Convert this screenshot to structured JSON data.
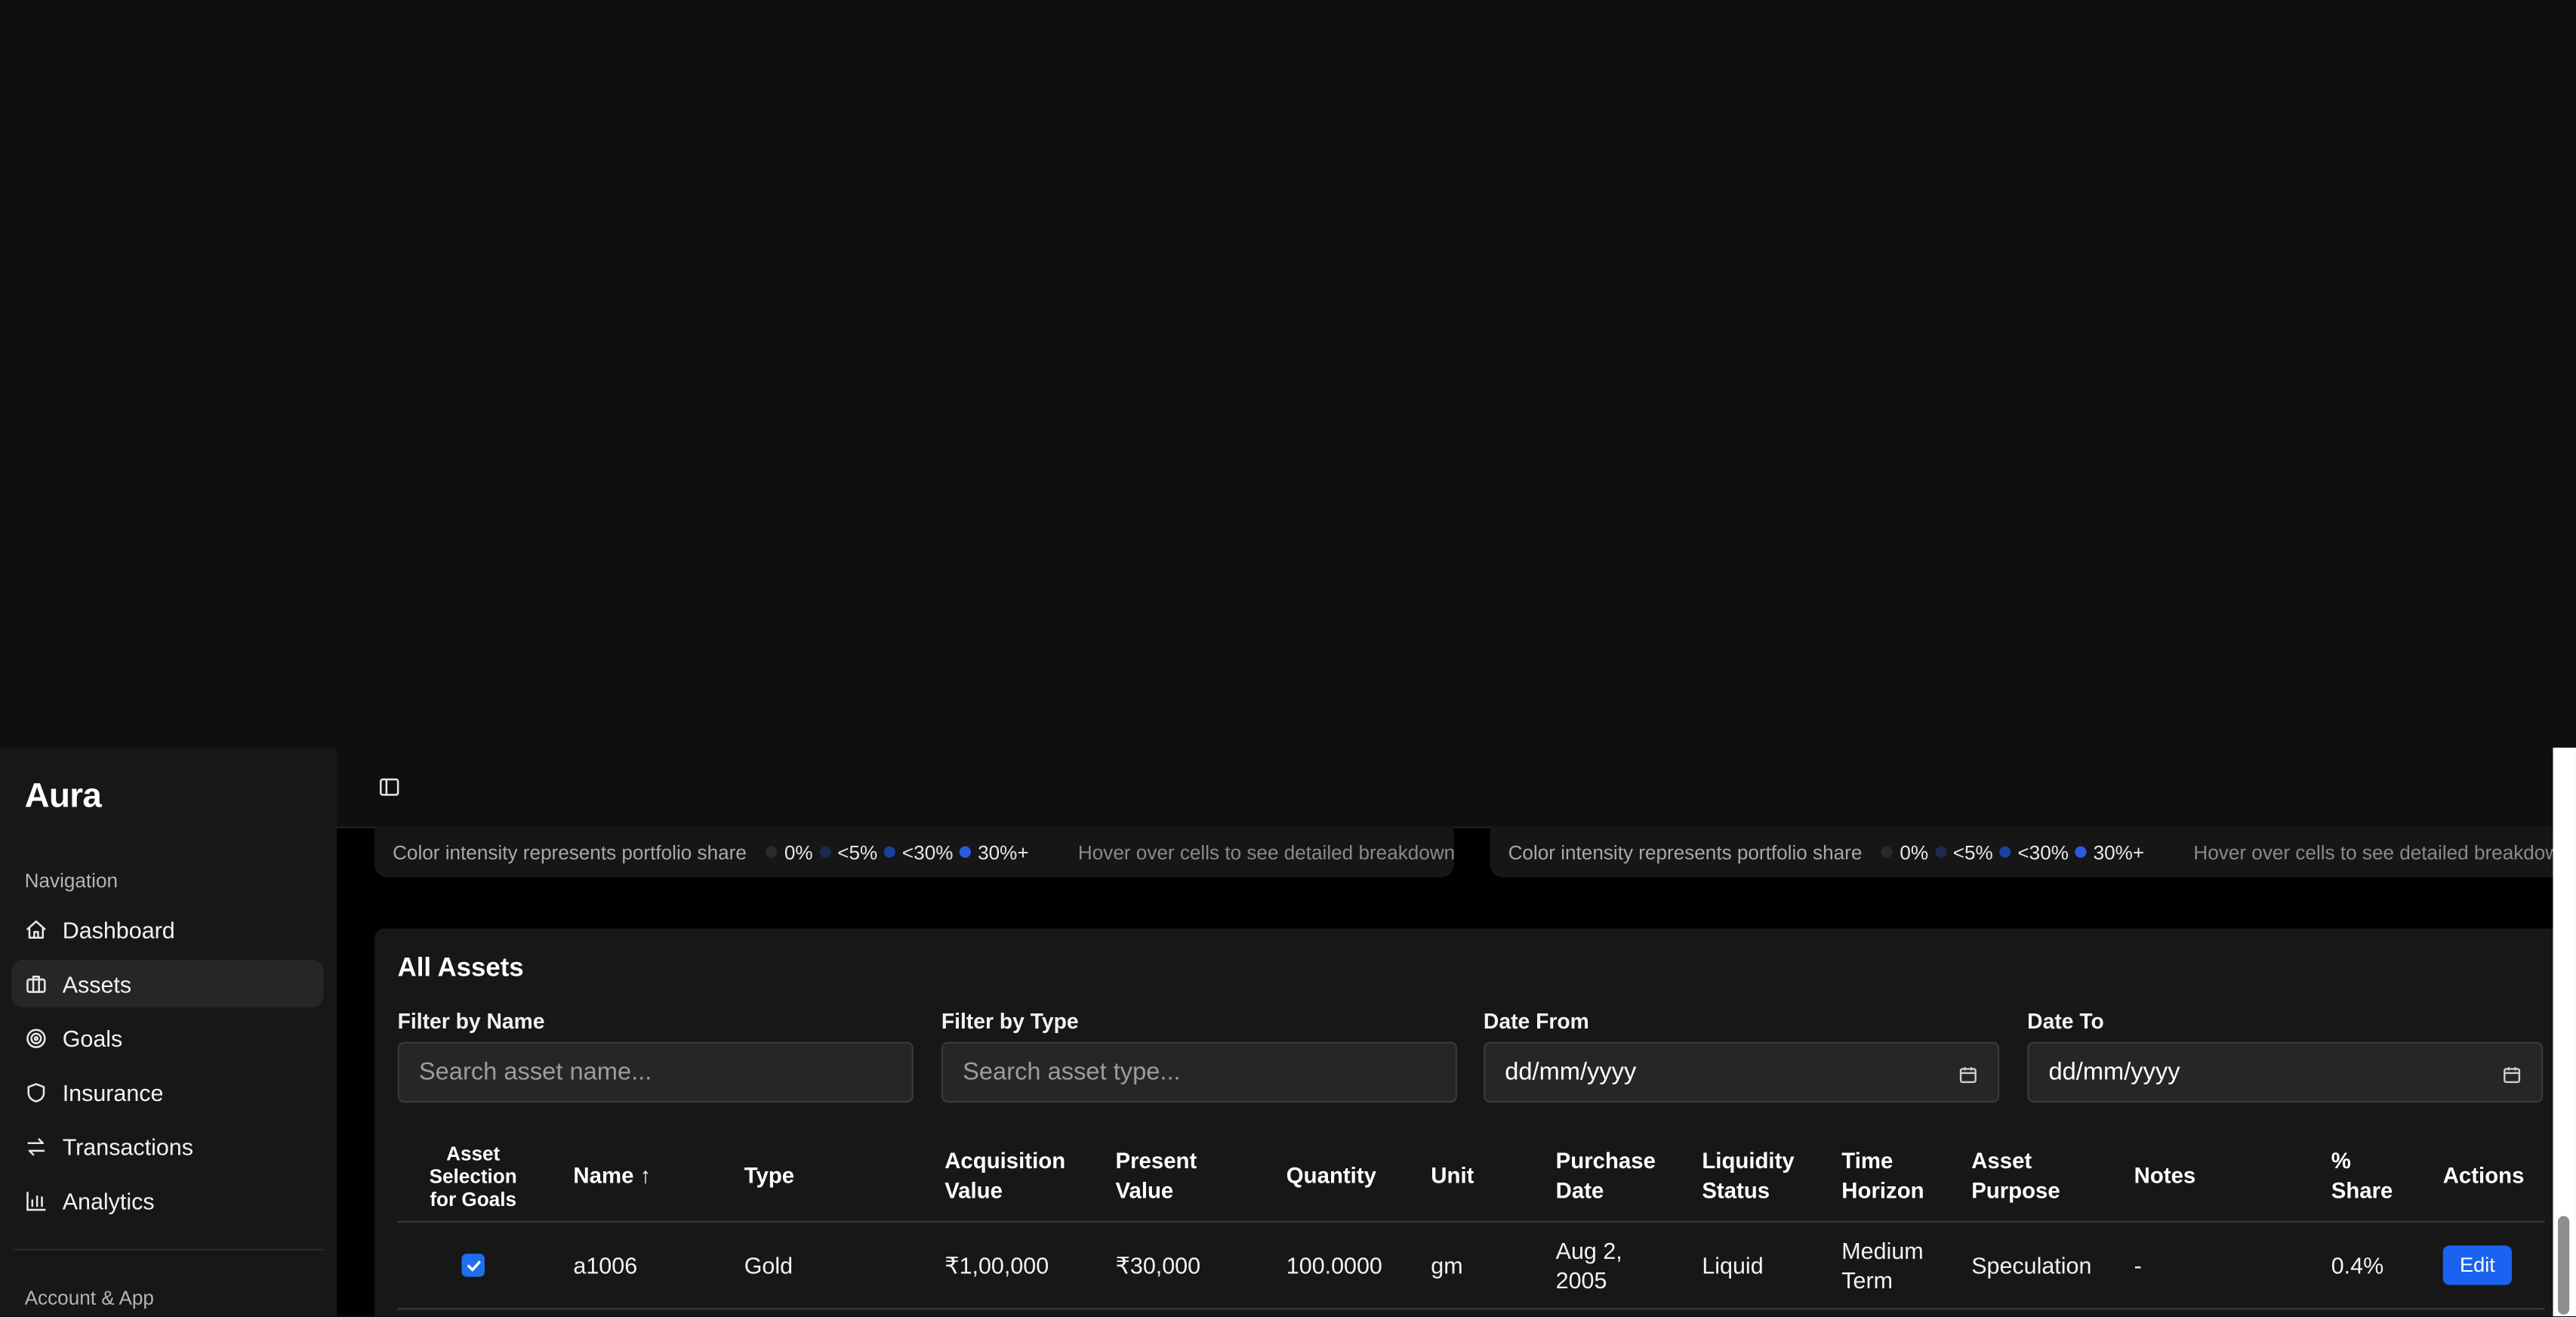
{
  "app": {
    "name": "Aura"
  },
  "sidebar": {
    "section_label": "Navigation",
    "items": [
      {
        "label": "Dashboard",
        "icon": "home-icon",
        "active": false
      },
      {
        "label": "Assets",
        "icon": "briefcase-icon",
        "active": true
      },
      {
        "label": "Goals",
        "icon": "target-icon",
        "active": false
      },
      {
        "label": "Insurance",
        "icon": "shield-icon",
        "active": false
      },
      {
        "label": "Transactions",
        "icon": "arrows-swap-icon",
        "active": false
      },
      {
        "label": "Analytics",
        "icon": "bar-chart-icon",
        "active": false
      }
    ],
    "section2_label": "Account & App"
  },
  "topbar": {
    "toggle_icon": "sidebar-toggle-icon"
  },
  "legend": {
    "lead": "Color intensity represents portfolio share",
    "items": [
      {
        "label": "0%",
        "color": "#2a2a2a"
      },
      {
        "label": "<5%",
        "color": "#1b2a4d"
      },
      {
        "label": "<30%",
        "color": "#1d3f9e"
      },
      {
        "label": "30%+",
        "color": "#2a5ce0"
      }
    ],
    "hover_hint": "Hover over cells to see detailed breakdown"
  },
  "assets": {
    "title": "All Assets",
    "filters": {
      "name": {
        "label": "Filter by Name",
        "placeholder": "Search asset name..."
      },
      "type": {
        "label": "Filter by Type",
        "placeholder": "Search asset type..."
      },
      "date_from": {
        "label": "Date From",
        "placeholder": "dd/mm/yyyy"
      },
      "date_to": {
        "label": "Date To",
        "placeholder": "dd/mm/yyyy"
      }
    },
    "columns": {
      "select": "Asset Selection for Goals",
      "name": "Name ↑",
      "type": "Type",
      "acq": "Acquisition Value",
      "present": "Present Value",
      "qty": "Quantity",
      "unit": "Unit",
      "purchase": "Purchase Date",
      "liquidity": "Liquidity Status",
      "horizon": "Time Horizon",
      "purpose": "Asset Purpose",
      "notes": "Notes",
      "share": "% Share",
      "actions": "Actions"
    },
    "rows": [
      {
        "selected": true,
        "name": "a1006",
        "type": "Gold",
        "acq": "₹1,00,000",
        "present": "₹30,000",
        "qty": "100.0000",
        "unit": "gm",
        "purchase": "Aug 2, 2005",
        "liquidity": "Liquid",
        "horizon": "Medium Term",
        "purpose": "Speculation",
        "notes": "-",
        "share": "0.4%",
        "action": "Edit"
      }
    ]
  }
}
